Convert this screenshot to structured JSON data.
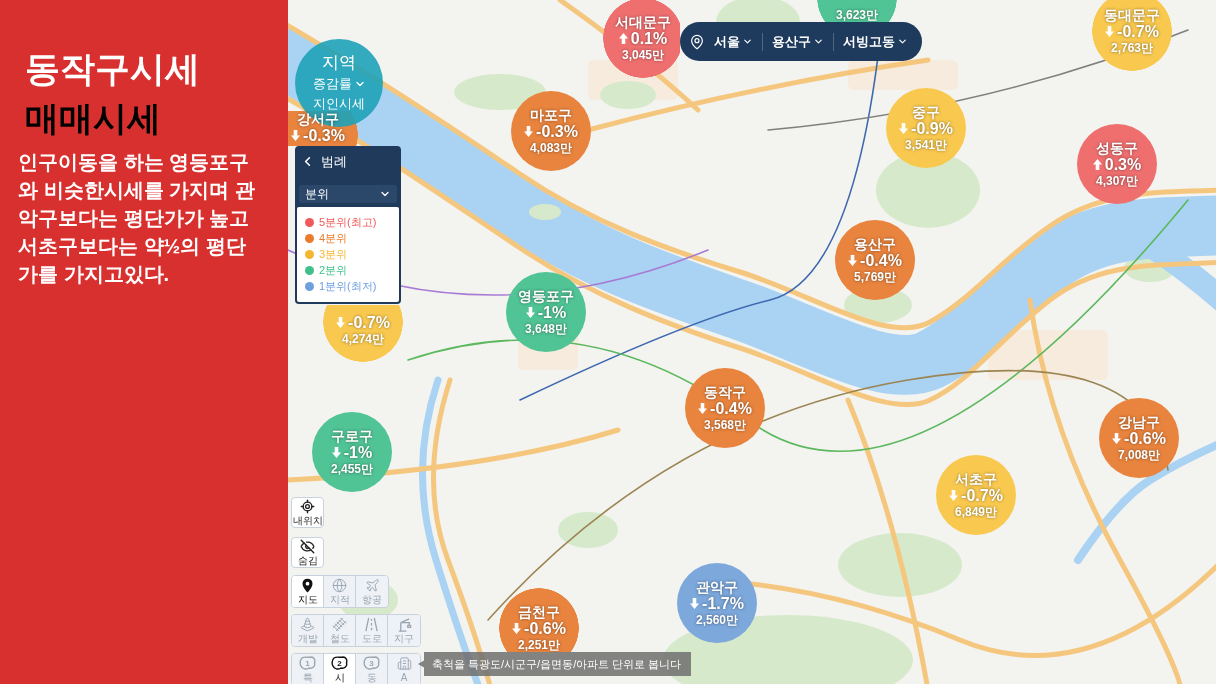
{
  "info_panel": {
    "title": "동작구시세",
    "subtitle": "매매시세",
    "description": "인구이동을 하는 영등포구와 비슷한시세를 가지며 관악구보다는 평단가가 높고 서초구보다는 약½의 평단가를 가지고있다."
  },
  "region_selector": {
    "label": "지역",
    "metric": "증감률",
    "source": "지인시세"
  },
  "location_bar": [
    "서울",
    "용산구",
    "서빙고동"
  ],
  "legend": {
    "title": "범례",
    "grouping": "분위",
    "items": [
      {
        "label": "5분위(최고)",
        "color": "#f05a5a"
      },
      {
        "label": "4분위",
        "color": "#ea7b2a"
      },
      {
        "label": "3분위",
        "color": "#f5b731"
      },
      {
        "label": "2분위",
        "color": "#3fbf8a"
      },
      {
        "label": "1분위(최저)",
        "color": "#6f9fdc"
      }
    ]
  },
  "districts": [
    {
      "name": "서대문구",
      "rising": true,
      "change": "0.1%",
      "price": "3,045만",
      "color": "#ef6f6f"
    },
    {
      "price": "3,623만",
      "color": "#50c495"
    },
    {
      "name": "동대문구",
      "rising": false,
      "change": "-0.7%",
      "price": "2,763만",
      "color": "#f9c94f"
    },
    {
      "name": "마포구",
      "rising": false,
      "change": "-0.3%",
      "price": "4,083만",
      "color": "#e9843e"
    },
    {
      "name": "중구",
      "rising": false,
      "change": "-0.9%",
      "price": "3,541만",
      "color": "#f9c94f"
    },
    {
      "name": "성동구",
      "rising": true,
      "change": "0.3%",
      "price": "4,307만",
      "color": "#ef6f6f"
    },
    {
      "name": "강서구",
      "rising": false,
      "change": "-0.3%",
      "color": "#e9843e"
    },
    {
      "name": "용산구",
      "rising": false,
      "change": "-0.4%",
      "price": "5,769만",
      "color": "#e9843e"
    },
    {
      "name": "영등포구",
      "rising": false,
      "change": "-1%",
      "price": "3,648만",
      "color": "#50c495"
    },
    {
      "rising": false,
      "change": "-0.7%",
      "price": "4,274만",
      "color": "#f9c94f"
    },
    {
      "name": "구로구",
      "rising": false,
      "change": "-1%",
      "price": "2,455만",
      "color": "#50c495"
    },
    {
      "name": "동작구",
      "rising": false,
      "change": "-0.4%",
      "price": "3,568만",
      "color": "#e9843e"
    },
    {
      "name": "강남구",
      "rising": false,
      "change": "-0.6%",
      "price": "7,008만",
      "color": "#e9843e"
    },
    {
      "name": "서초구",
      "rising": false,
      "change": "-0.7%",
      "price": "6,849만",
      "color": "#f9c94f"
    },
    {
      "name": "관악구",
      "rising": false,
      "change": "-1.7%",
      "price": "2,560만",
      "color": "#7ca8dc"
    },
    {
      "name": "금천구",
      "rising": false,
      "change": "-0.6%",
      "price": "2,251만",
      "color": "#e9843e"
    }
  ],
  "map_controls": {
    "locate": "내위치",
    "hide": "숨김",
    "map_types": [
      {
        "label": "지도",
        "selected": true
      },
      {
        "label": "지적",
        "selected": false
      },
      {
        "label": "항공",
        "selected": false
      }
    ],
    "layers": [
      {
        "label": "개발",
        "on": false
      },
      {
        "label": "철도",
        "on": false
      },
      {
        "label": "도로",
        "on": false
      },
      {
        "label": "지구",
        "on": false
      }
    ],
    "scales": [
      {
        "badge": "1",
        "label": "특",
        "selected": false
      },
      {
        "badge": "2",
        "label": "시",
        "selected": true
      },
      {
        "badge": "3",
        "label": "동",
        "selected": false
      },
      {
        "label": "A",
        "selected": false
      }
    ]
  },
  "scale_hint": "축척을 특광도/시군구/읍면동/아파트 단위로 봅니다"
}
